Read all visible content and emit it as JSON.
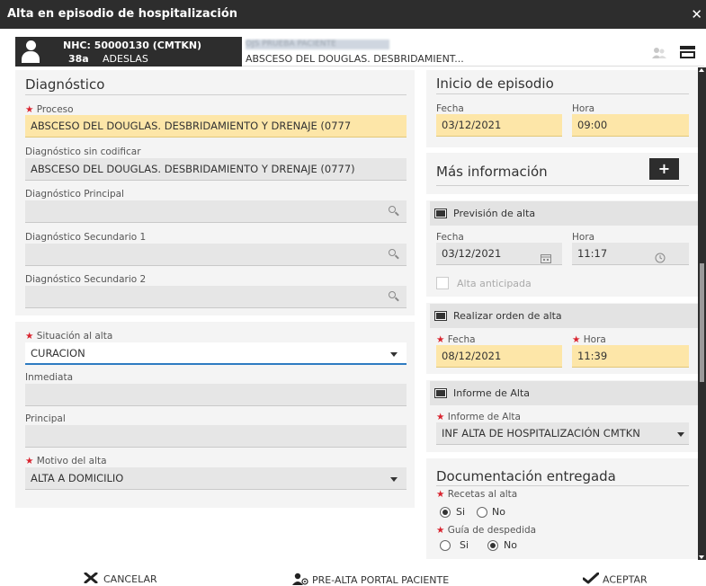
{
  "window": {
    "title": "Alta en episodio de hospitalización",
    "close": "✕"
  },
  "patient": {
    "nhc": "NHC: 50000130 (CMTKN)",
    "age": "38a",
    "insurer": "ADESLAS",
    "name_blurred": "OJS PRUEBA PACIENTE",
    "diagnosis": "ABSCESO DEL DOUGLAS. DESBRIDAMIENT..."
  },
  "diagnostico": {
    "title": "Diagnóstico",
    "proceso": {
      "label": "Proceso",
      "value": "ABSCESO DEL DOUGLAS. DESBRIDAMIENTO Y DRENAJE (0777"
    },
    "sin_codificar": {
      "label": "Diagnóstico sin codificar",
      "value": "ABSCESO DEL DOUGLAS. DESBRIDAMIENTO Y DRENAJE (0777)"
    },
    "principal": {
      "label": "Diagnóstico Principal",
      "value": ""
    },
    "secundario1": {
      "label": "Diagnóstico Secundario 1",
      "value": ""
    },
    "secundario2": {
      "label": "Diagnóstico Secundario 2",
      "value": ""
    }
  },
  "situacion": {
    "situacion_alta": {
      "label": "Situación al alta",
      "value": "CURACION"
    },
    "inmediata": {
      "label": "Inmediata",
      "value": ""
    },
    "principal": {
      "label": "Principal",
      "value": ""
    },
    "motivo_alta": {
      "label": "Motivo del alta",
      "value": "ALTA A DOMICILIO"
    }
  },
  "inicio": {
    "title": "Inicio de episodio",
    "fecha_label": "Fecha",
    "fecha": "03/12/2021",
    "hora_label": "Hora",
    "hora": "09:00"
  },
  "mas_info": {
    "title": "Más información",
    "button": "+"
  },
  "prevision": {
    "label": "Previsión de alta",
    "fecha_label": "Fecha",
    "fecha": "03/12/2021",
    "hora_label": "Hora",
    "hora": "11:17",
    "anticipada": "Alta anticipada"
  },
  "orden": {
    "label": "Realizar orden de alta",
    "fecha_label": "Fecha",
    "fecha": "08/12/2021",
    "hora_label": "Hora",
    "hora": "11:39"
  },
  "informe": {
    "label": "Informe de Alta",
    "field_label": "Informe de Alta",
    "value": "INF ALTA DE HOSPITALIZACIÓN CMTKN"
  },
  "documentacion": {
    "title": "Documentación entregada",
    "recetas": {
      "label": "Recetas al alta",
      "si": "Si",
      "no": "No",
      "selected": "Si"
    },
    "guia": {
      "label": "Guía de despedida",
      "si": "Si",
      "no": "No",
      "selected": "No"
    }
  },
  "footer": {
    "cancel": "CANCELAR",
    "prealta": "PRE-ALTA PORTAL PACIENTE",
    "accept": "ACEPTAR"
  },
  "icons": [
    "close-icon",
    "user-icon",
    "users-icon",
    "print-icon",
    "search-icon",
    "chevron-down-icon",
    "calendar-icon",
    "clock-icon",
    "plus-icon",
    "x-icon",
    "check-icon"
  ]
}
